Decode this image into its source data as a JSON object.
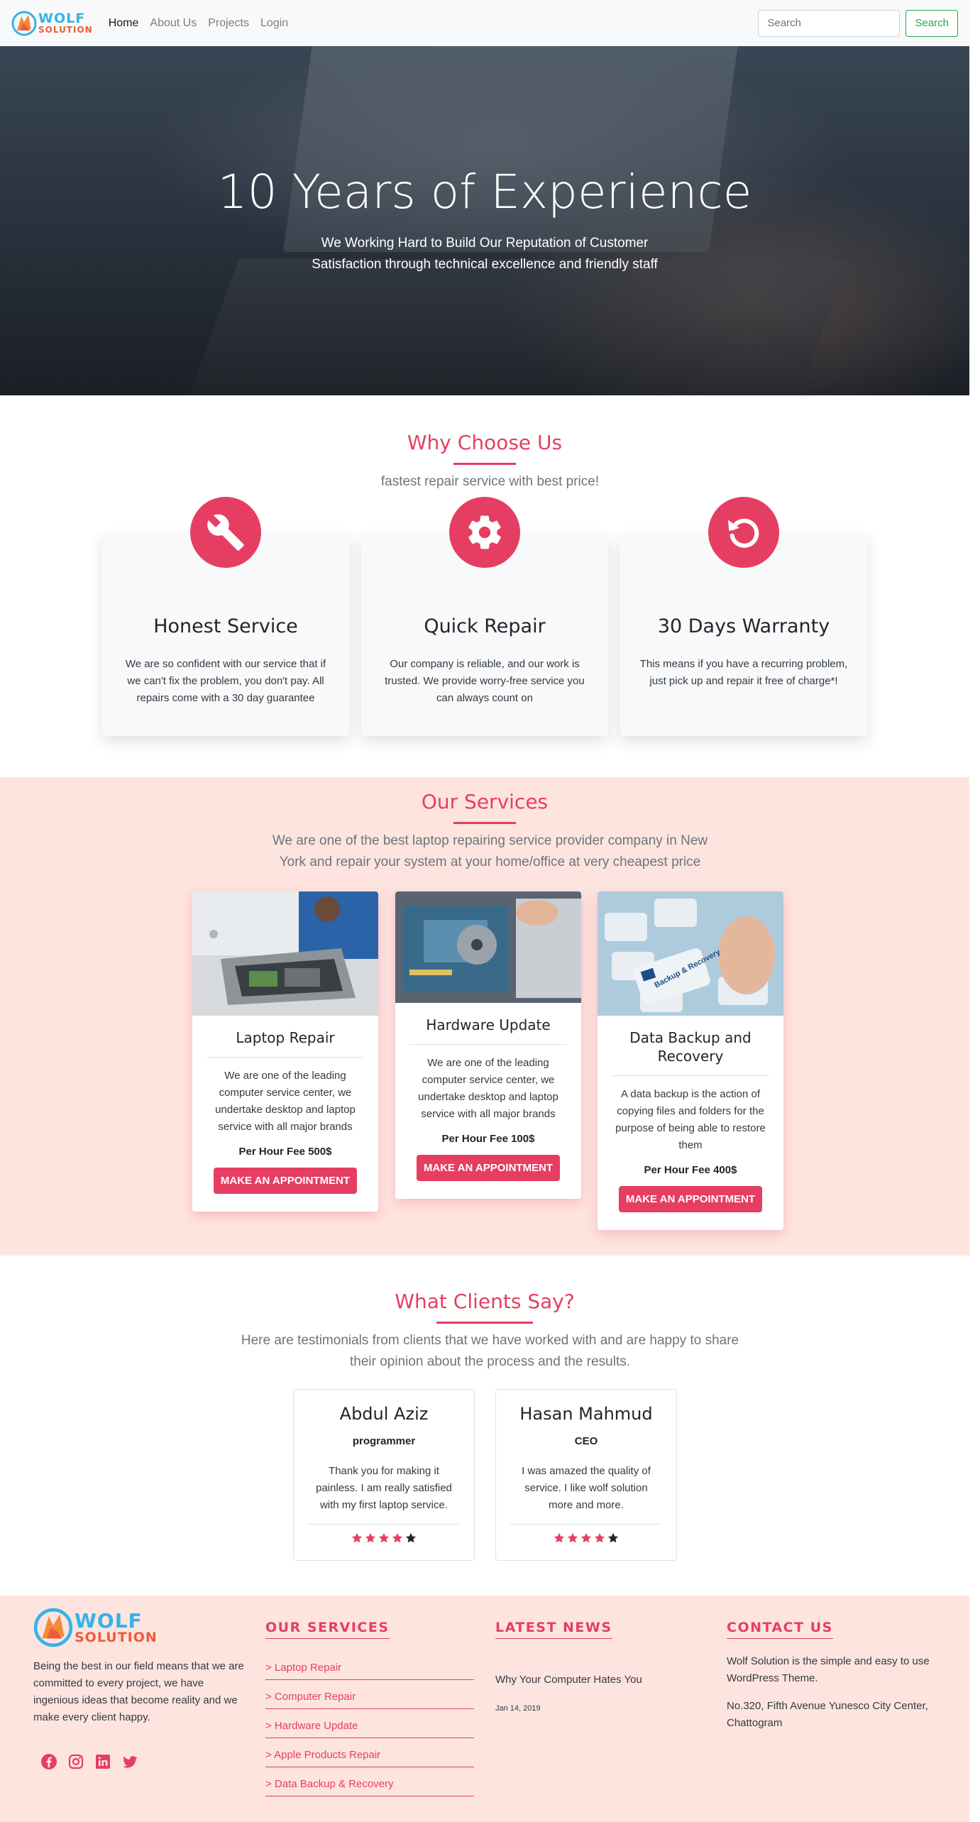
{
  "nav": {
    "logo_line1": "WOLF",
    "logo_line2": "SOLUTION",
    "links": [
      "Home",
      "About Us",
      "Projects",
      "Login"
    ],
    "search_placeholder": "Search",
    "search_button": "Search"
  },
  "hero": {
    "title": "10 Years of Experience",
    "subtitle": "We Working Hard to Build Our Reputation of Customer Satisfaction through technical excellence and friendly staff"
  },
  "why": {
    "title": "Why Choose Us",
    "subtitle": "fastest repair service with best price!",
    "cards": [
      {
        "title": "Honest Service",
        "text": "We are so confident with our service that if we can't fix the problem, you don't pay. All repairs come with a 30 day guarantee",
        "icon": "wrench-icon"
      },
      {
        "title": "Quick Repair",
        "text": "Our company is reliable, and our work is trusted. We provide worry-free service you can always count on",
        "icon": "gear-icon"
      },
      {
        "title": "30 Days Warranty",
        "text": "This means if you have a recurring problem, just pick up and repair it free of charge*!",
        "icon": "undo-icon"
      }
    ]
  },
  "services": {
    "title": "Our Services",
    "subtitle": "We are one of the best laptop repairing service provider company in New York and repair your system at your home/office at very cheapest price",
    "button_label": "MAKE AN APPOINTMENT",
    "cards": [
      {
        "title": "Laptop Repair",
        "text": "We are one of the leading computer service center, we undertake desktop and laptop service with all major brands",
        "fee": "Per Hour Fee 500$"
      },
      {
        "title": "Hardware Update",
        "text": "We are one of the leading computer service center, we undertake desktop and laptop service with all major brands",
        "fee": "Per Hour Fee 100$"
      },
      {
        "title": "Data Backup and Recovery",
        "text": "A data backup is the action of copying files and folders for the purpose of being able to restore them",
        "fee": "Per Hour Fee 400$",
        "image_key_label": "Backup & Recovery"
      }
    ]
  },
  "clients": {
    "title": "What Clients Say?",
    "subtitle": "Here are testimonials from clients that we have worked with and are happy to share their opinion about the process and the results.",
    "cards": [
      {
        "name": "Abdul Aziz",
        "role": "programmer",
        "quote": "Thank you for making it painless. I am really satisfied with my first laptop service.",
        "rating": 4,
        "max": 5
      },
      {
        "name": "Hasan Mahmud",
        "role": "CEO",
        "quote": "I was amazed the quality of service. I like wolf solution more and more.",
        "rating": 4,
        "max": 5
      }
    ]
  },
  "footer": {
    "about": "Being the best in our field means that we are committed to every project, we have ingenious ideas that become reality and we make every client happy.",
    "social": [
      "facebook-icon",
      "instagram-icon",
      "linkedin-icon",
      "twitter-icon"
    ],
    "services_title": "OUR SERVICES",
    "services_links": [
      "> Laptop Repair",
      "> Computer Repair",
      "> Hardware Update",
      "> Apple Products Repair",
      "> Data Backup & Recovery"
    ],
    "news_title": "LATEST NEWS",
    "news_item": "Why Your Computer Hates You",
    "news_date": "Jan 14, 2019",
    "contact_title": "CONTACT US",
    "contact_text1": "Wolf Solution is the simple and easy to use WordPress Theme.",
    "contact_text2": "No.320, Fifth Avenue Yunesco City Center, Chattogram"
  },
  "colors": {
    "accent": "#e63e62",
    "section_bg": "#fde4df",
    "nav_bg": "#f8f9fa"
  }
}
